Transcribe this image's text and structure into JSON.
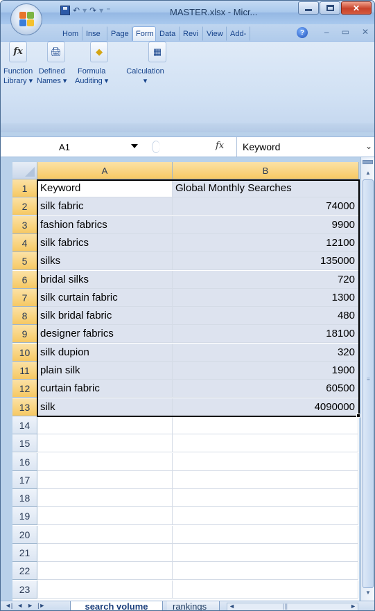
{
  "window": {
    "title": "MASTER.xlsx - Micr...",
    "qat_undo": "↶",
    "qat_redo": "↷",
    "qat_sep": "⁼"
  },
  "ribbon": {
    "tabs": [
      "Hom",
      "Inse",
      "Page",
      "Form",
      "Data",
      "Revi",
      "View",
      "Add-"
    ],
    "active_tab": "Form",
    "groups": [
      {
        "label_line1": "Function",
        "label_line2": "Library ▾",
        "icon": "function-icon"
      },
      {
        "label_line1": "Defined",
        "label_line2": "Names ▾",
        "icon": "defined-names-icon"
      },
      {
        "label_line1": "Formula",
        "label_line2": "Auditing ▾",
        "icon": "formula-auditing-icon"
      },
      {
        "label_line1": "Calculation",
        "label_line2": "▾",
        "icon": "calculation-icon"
      }
    ]
  },
  "formula_bar": {
    "name_box": "A1",
    "fx": "fx",
    "value": "Keyword"
  },
  "sheet": {
    "columns": [
      "A",
      "B"
    ],
    "rows": [
      {
        "n": "1",
        "a": "Keyword",
        "b": "Global Monthly Searches"
      },
      {
        "n": "2",
        "a": "silk fabric",
        "b": "74000"
      },
      {
        "n": "3",
        "a": "fashion fabrics",
        "b": "9900"
      },
      {
        "n": "4",
        "a": "silk fabrics",
        "b": "12100"
      },
      {
        "n": "5",
        "a": "silks",
        "b": "135000"
      },
      {
        "n": "6",
        "a": "bridal silks",
        "b": "720"
      },
      {
        "n": "7",
        "a": "silk curtain fabric",
        "b": "1300"
      },
      {
        "n": "8",
        "a": "silk bridal fabric",
        "b": "480"
      },
      {
        "n": "9",
        "a": "designer fabrics",
        "b": "18100"
      },
      {
        "n": "10",
        "a": "silk dupion",
        "b": "320"
      },
      {
        "n": "11",
        "a": "plain silk",
        "b": "1900"
      },
      {
        "n": "12",
        "a": "curtain fabric",
        "b": "60500"
      },
      {
        "n": "13",
        "a": "silk",
        "b": "4090000"
      },
      {
        "n": "14",
        "a": "",
        "b": ""
      },
      {
        "n": "15",
        "a": "",
        "b": ""
      },
      {
        "n": "16",
        "a": "",
        "b": ""
      },
      {
        "n": "17",
        "a": "",
        "b": ""
      },
      {
        "n": "18",
        "a": "",
        "b": ""
      },
      {
        "n": "19",
        "a": "",
        "b": ""
      },
      {
        "n": "20",
        "a": "",
        "b": ""
      },
      {
        "n": "21",
        "a": "",
        "b": ""
      },
      {
        "n": "22",
        "a": "",
        "b": ""
      },
      {
        "n": "23",
        "a": "",
        "b": ""
      }
    ]
  },
  "sheet_tabs": {
    "active": "search volume",
    "other": "rankings",
    "nav": [
      "◄|",
      "◄",
      "►",
      "|►"
    ]
  },
  "colors": {
    "selected_header": "#f6c863",
    "selection_fill": "#dde3ef",
    "ribbon_text": "#15428b"
  }
}
